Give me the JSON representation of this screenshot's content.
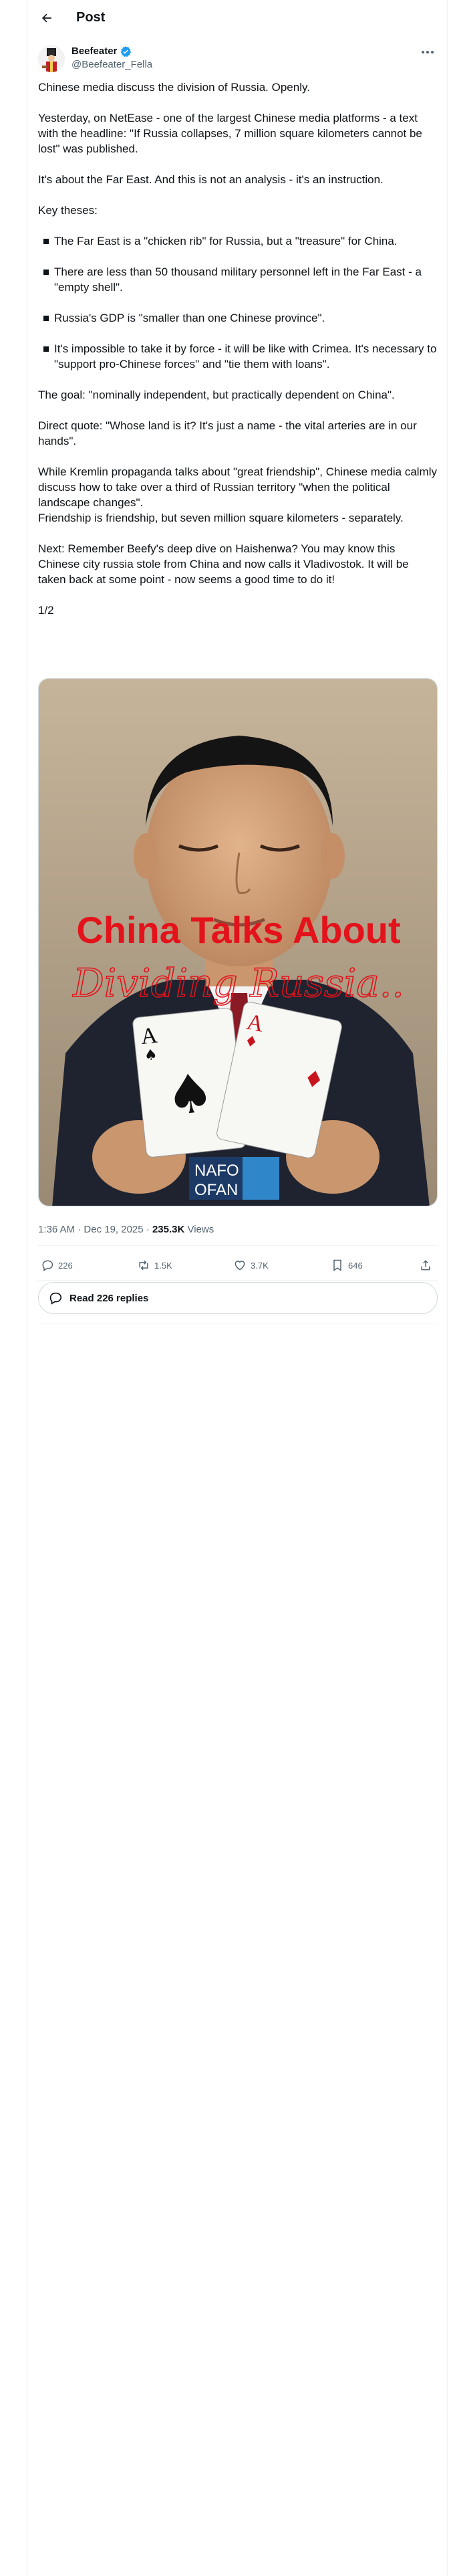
{
  "header": {
    "title": "Post",
    "back_icon": "arrow-left-icon"
  },
  "author": {
    "display_name": "Beefeater",
    "handle": "@Beefeater_Fella",
    "verified": true,
    "verified_color": "#1d9bf0"
  },
  "tweet": {
    "p1": "Chinese media discuss the division of Russia. Openly.",
    "p2": "Yesterday, on NetEase - one of the largest Chinese media platforms - a text with the headline: \"If Russia collapses, 7 million square kilometers cannot be lost\" was published.",
    "p3": "It's about the Far East. And this is not an analysis - it's an instruction.",
    "p4": "Key theses:",
    "bullets": [
      "The Far East is a \"chicken rib\" for Russia, but a \"treasure\" for China.",
      "There are less than 50 thousand military personnel left in the Far East - a \"empty shell\".",
      "Russia's GDP is \"smaller than one Chinese province\".",
      "It's impossible to take it by force - it will be like with Crimea. It's necessary to \"support pro-Chinese forces\" and \"tie them with loans\"."
    ],
    "p5": "The goal: \"nominally independent, but practically dependent on China\".",
    "p6": "Direct quote: \"Whose land is it? It's just a name - the vital arteries are in our hands\".",
    "p7a": "While Kremlin propaganda talks about \"great friendship\", Chinese media calmly discuss how to take over a third of Russian territory \"when the political landscape changes\".",
    "p7b": "Friendship is friendship, but seven million square kilometers - separately.",
    "p8": "Next: Remember Beefy's deep dive on Haishenwa? You may know this Chinese city russia stole from China and now calls it Vladivostok. It will be taken back at some point - now seems a good time to do it!",
    "p9": "1/2"
  },
  "media": {
    "headline": "China Talks About",
    "subheadline": "Dividing Russia..",
    "badge_line1": "NAFO",
    "badge_line2": "OFAN",
    "headline_color": "#e3121b"
  },
  "meta": {
    "time": "1:36 AM",
    "separator": " · ",
    "date": "Dec 19, 2025",
    "views_count": "235.3K",
    "views_label": " Views"
  },
  "actions": {
    "replies": "226",
    "reposts": "1.5K",
    "likes": "3.7K",
    "bookmarks": "646"
  },
  "read_replies": "Read 226 replies"
}
